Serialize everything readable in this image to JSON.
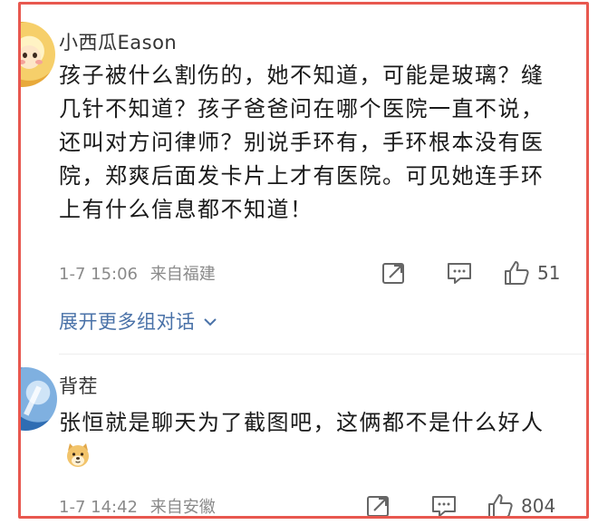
{
  "comments": [
    {
      "username": "小西瓜Eason",
      "text": "孩子被什么割伤的，她不知道，可能是玻璃？缝几针不知道？孩子爸爸问在哪个医院一直不说，还叫对方问律师？别说手环有，手环根本没有医院，郑爽后面发卡片上才有医院。可见她连手环上有什么信息都不知道！",
      "time": "1-7 15:06",
      "source": "来自福建",
      "likes": "51"
    },
    {
      "username": "背茬",
      "text": "张恒就是聊天为了截图吧，这俩都不是什么好人",
      "time": "1-7 14:42",
      "source": "来自安徽",
      "likes": "804"
    }
  ],
  "expand_replies": "展开更多组对话",
  "icons": {
    "share": "share-icon",
    "comment": "comment-icon",
    "like": "thumbs-up-icon",
    "expand": "chevron-down-icon",
    "emoji": "doge-emoji-icon"
  },
  "colors": {
    "frame_border": "#e8584f",
    "link": "#4a72a8",
    "meta_text": "#8a8a8a"
  }
}
